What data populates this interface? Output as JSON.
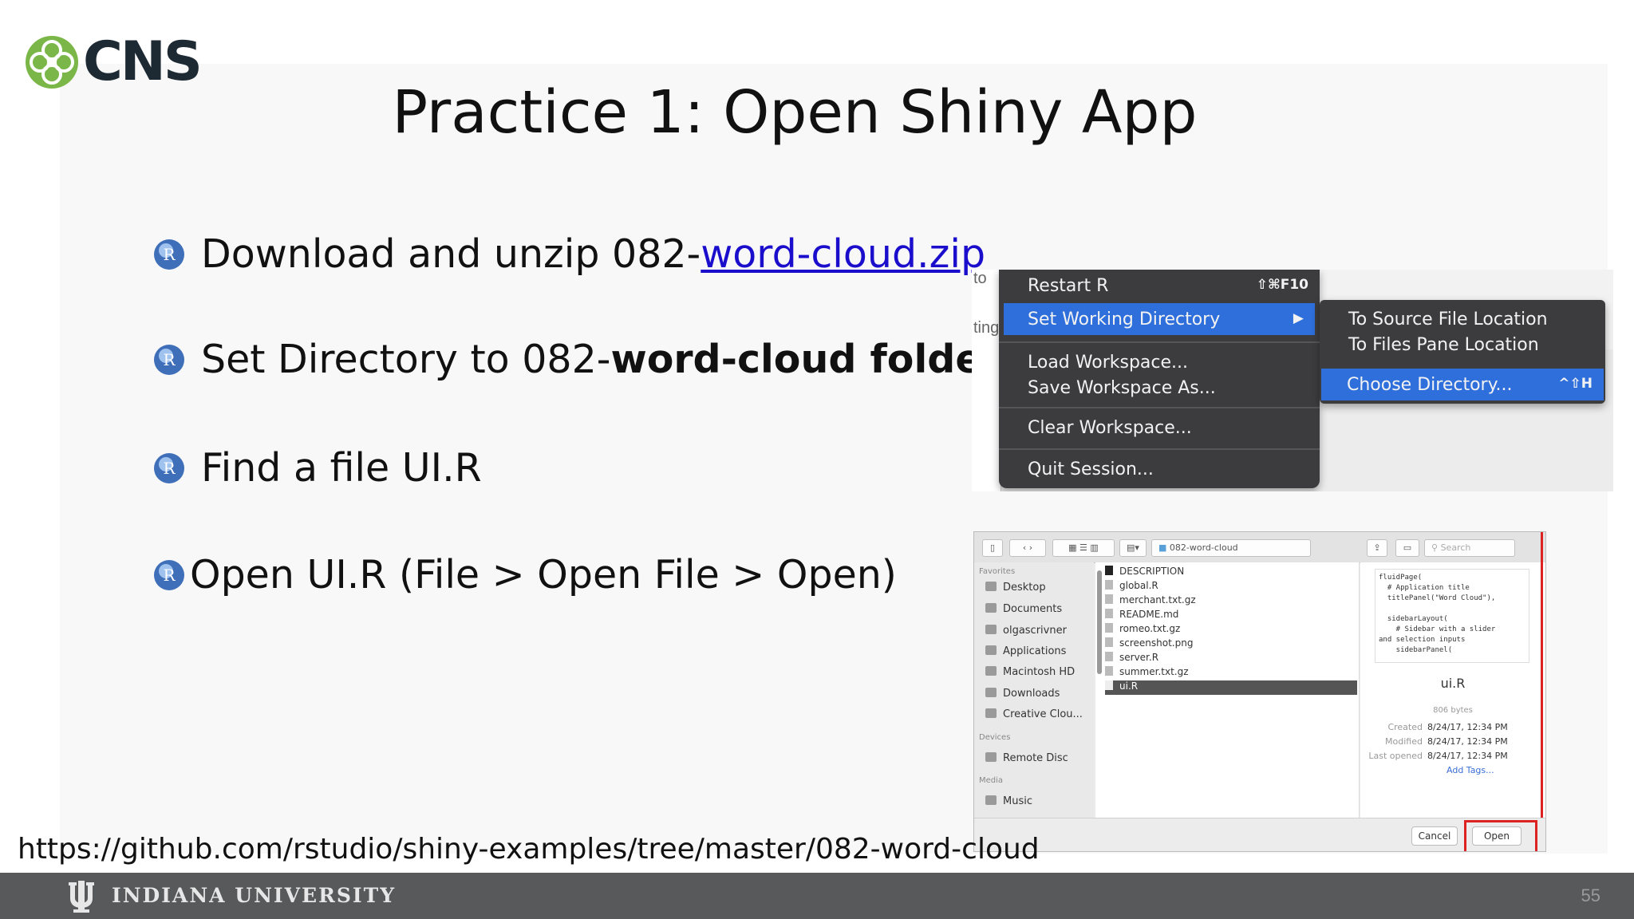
{
  "logo": {
    "text": "CNS"
  },
  "title": "Practice 1: Open Shiny App",
  "bullets": [
    {
      "prefix": "Download and unzip 082-",
      "link": "word-cloud.zip"
    },
    {
      "prefix": "Set Directory  to 082-",
      "bold": "word-cloud folder"
    },
    {
      "text": "Find a file UI.R"
    },
    {
      "text": "Open UI.R (File > Open File > Open)"
    }
  ],
  "source_url": "https://github.com/rstudio/shiny-examples/tree/master/082-word-cloud",
  "footer": {
    "university": "INDIANA UNIVERSITY",
    "page_number": "55"
  },
  "session_menu": {
    "edge_labels": [
      "to",
      "ting"
    ],
    "items": [
      {
        "label": "Restart R",
        "shortcut": "⇧⌘F10"
      },
      {
        "label": "Set Working Directory",
        "shortcut": "▶",
        "selected": true
      },
      {
        "label": "Load Workspace..."
      },
      {
        "label": "Save Workspace As..."
      },
      {
        "label": "Clear Workspace..."
      },
      {
        "label": "Quit Session..."
      }
    ],
    "submenu": [
      {
        "label": "To Source File Location"
      },
      {
        "label": "To Files Pane Location"
      },
      {
        "label": "Choose Directory...",
        "shortcut": "^⇧H",
        "selected": true
      }
    ]
  },
  "file_dialog": {
    "folder": "082-word-cloud",
    "search_placeholder": "Search",
    "sidebar": {
      "favorites_header": "Favorites",
      "favorites": [
        "Desktop",
        "Documents",
        "olgascrivner",
        "Applications",
        "Macintosh HD",
        "Downloads",
        "Creative Clou..."
      ],
      "devices_header": "Devices",
      "devices": [
        "Remote Disc"
      ],
      "media_header": "Media",
      "media": [
        "Music"
      ]
    },
    "files": [
      "DESCRIPTION",
      "global.R",
      "merchant.txt.gz",
      "README.md",
      "romeo.txt.gz",
      "screenshot.png",
      "server.R",
      "summer.txt.gz",
      "ui.R"
    ],
    "selected_file": "ui.R",
    "preview_code": "fluidPage(\n  # Application title\n  titlePanel(\"Word Cloud\"),\n\n  sidebarLayout(\n    # Sidebar with a slider\nand selection inputs\n    sidebarPanel(",
    "preview_name": "ui.R",
    "preview_size": "806 bytes",
    "meta": [
      {
        "label": "Created",
        "value": "8/24/17, 12:34 PM"
      },
      {
        "label": "Modified",
        "value": "8/24/17, 12:34 PM"
      },
      {
        "label": "Last opened",
        "value": "8/24/17, 12:34 PM"
      }
    ],
    "add_tags": "Add Tags...",
    "cancel_label": "Cancel",
    "open_label": "Open"
  }
}
